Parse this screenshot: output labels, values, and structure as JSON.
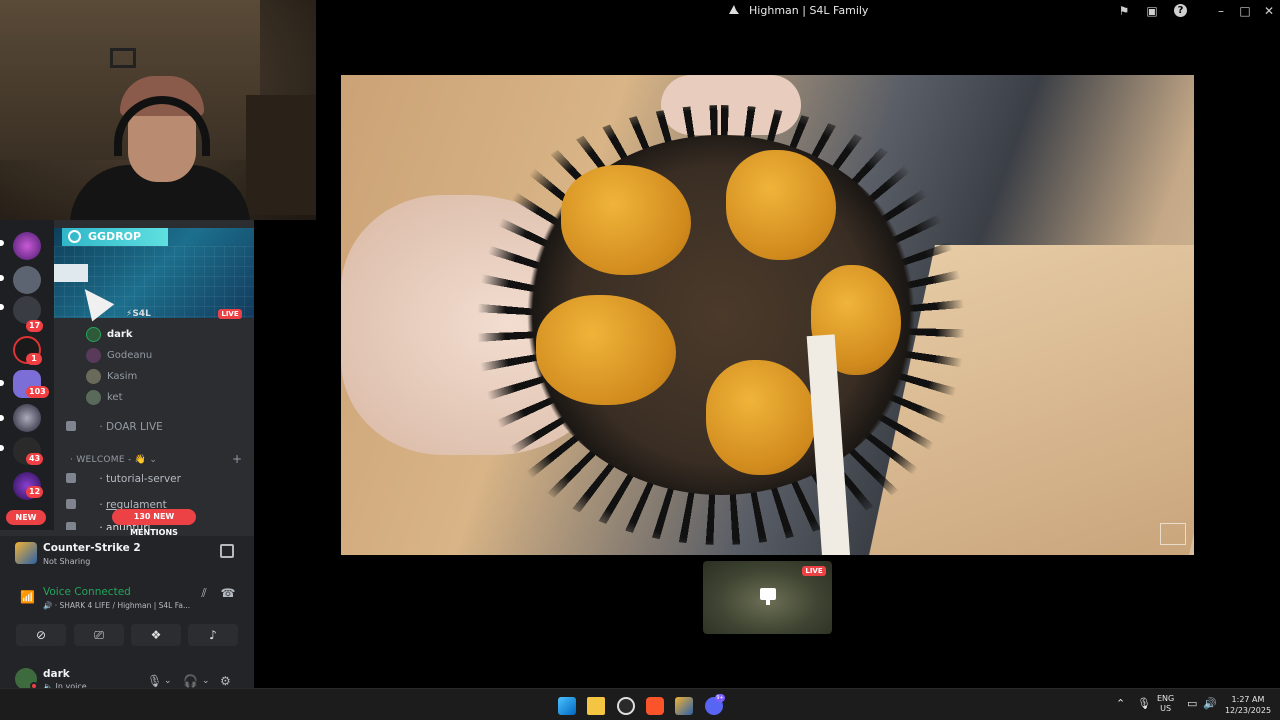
{
  "window": {
    "title": "Highman | S4L Family"
  },
  "banner": {
    "brand": "GGDROP"
  },
  "voice_channel": {
    "stream_owner": "S4L",
    "live_label": "LIVE",
    "members": [
      {
        "name": "dark",
        "active": true
      },
      {
        "name": "Godeanu",
        "active": false
      },
      {
        "name": "Kasim",
        "active": false
      },
      {
        "name": "ket",
        "active": false
      }
    ]
  },
  "channels": {
    "doar_live": "DOAR LIVE",
    "category_welcome": "WELCOME - 👋",
    "tutorial": "tutorial-server",
    "regulament": "regulament",
    "anunturi": "anunturi"
  },
  "server_badges": [
    "17",
    "1",
    "103",
    "43",
    "12"
  ],
  "pills": {
    "new": "NEW",
    "mentions": "130 NEW MENTIONS"
  },
  "activity": {
    "game": "Counter-Strike 2",
    "status": "Not Sharing"
  },
  "voice_status": {
    "title": "Voice Connected",
    "channel": "SHARK 4 LIFE / Highman | S4L Fa..."
  },
  "user": {
    "name": "dark",
    "status": "In voice"
  },
  "thumbnail": {
    "live_label": "LIVE"
  },
  "taskbar": {
    "lang_line1": "ENG",
    "lang_line2": "US",
    "time": "1:27 AM",
    "date": "12/23/2025",
    "discord_badge": "9+"
  },
  "colors": {
    "discord_bg": "#2b2d31",
    "server_rail": "#1e1f22",
    "panel": "#232428",
    "voice_green": "#23a55a",
    "live_red": "#ed4245",
    "taskbar": "#1c1c1c"
  }
}
